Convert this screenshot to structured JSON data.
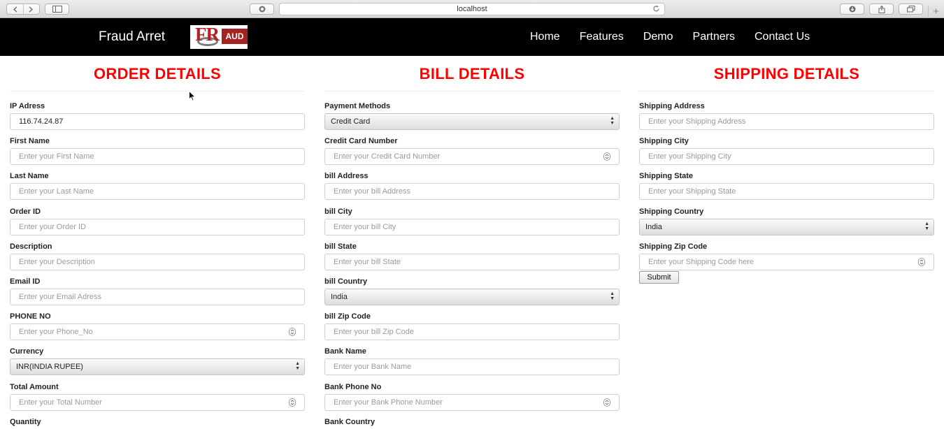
{
  "browser": {
    "url": "localhost"
  },
  "site": {
    "brand": "Fraud Arret",
    "logo_text": "FRAUD",
    "nav": [
      "Home",
      "Features",
      "Demo",
      "Partners",
      "Contact Us"
    ]
  },
  "order": {
    "title": "ORDER DETAILS",
    "fields": [
      {
        "label": "IP Adress",
        "value": "116.74.24.87",
        "kind": "text"
      },
      {
        "label": "First Name",
        "placeholder": "Enter your First Name",
        "kind": "text"
      },
      {
        "label": "Last Name",
        "placeholder": "Enter your Last Name",
        "kind": "text"
      },
      {
        "label": "Order ID",
        "placeholder": "Enter your Order ID",
        "kind": "text"
      },
      {
        "label": "Description",
        "placeholder": "Enter your Description",
        "kind": "text"
      },
      {
        "label": "Email ID",
        "placeholder": "Enter your Email Adress",
        "kind": "text"
      },
      {
        "label": "PHONE NO",
        "placeholder": "Enter your Phone_No",
        "kind": "number"
      },
      {
        "label": "Currency",
        "value": "INR(INDIA RUPEE)",
        "kind": "select"
      },
      {
        "label": "Total Amount",
        "placeholder": "Enter your Total Number",
        "kind": "number"
      },
      {
        "label": "Quantity"
      }
    ]
  },
  "bill": {
    "title": "BILL DETAILS",
    "fields": [
      {
        "label": "Payment Methods",
        "value": "Credit Card",
        "kind": "select"
      },
      {
        "label": "Credit Card Number",
        "placeholder": "Enter your Credit Card Number",
        "kind": "number"
      },
      {
        "label": "bill Address",
        "placeholder": "Enter your bill Address",
        "kind": "text"
      },
      {
        "label": "bill City",
        "placeholder": "Enter your bill City",
        "kind": "text"
      },
      {
        "label": "bill State",
        "placeholder": "Enter your bill State",
        "kind": "text"
      },
      {
        "label": "bill Country",
        "value": "India",
        "kind": "select"
      },
      {
        "label": "bill Zip Code",
        "placeholder": "Enter your bill Zip Code",
        "kind": "text"
      },
      {
        "label": "Bank Name",
        "placeholder": "Enter your Bank Name",
        "kind": "text"
      },
      {
        "label": "Bank Phone No",
        "placeholder": "Enter your Bank Phone Number",
        "kind": "number"
      },
      {
        "label": "Bank Country"
      }
    ]
  },
  "shipping": {
    "title": "SHIPPING DETAILS",
    "fields": [
      {
        "label": "Shipping Address",
        "placeholder": "Enter your Shipping Address",
        "kind": "text"
      },
      {
        "label": "Shipping City",
        "placeholder": "Enter your Shipping City",
        "kind": "text"
      },
      {
        "label": "Shipping State",
        "placeholder": "Enter your Shipping State",
        "kind": "text"
      },
      {
        "label": "Shipping Country",
        "value": "India",
        "kind": "select"
      },
      {
        "label": "Shipping Zip Code",
        "placeholder": "Enter your Shipping Code here",
        "kind": "number"
      }
    ],
    "submit_label": "Submit"
  }
}
